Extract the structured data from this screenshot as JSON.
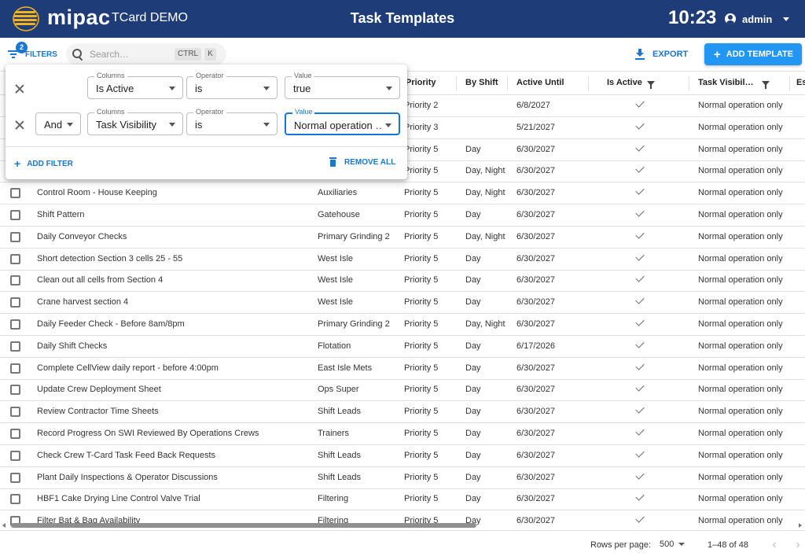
{
  "header": {
    "brand": "mipac",
    "org": "TCard DEMO",
    "title": "Task Templates",
    "clock": "10:23",
    "user": "admin"
  },
  "toolbar": {
    "filters_label": "FILTERS",
    "filter_count": "2",
    "search_placeholder": "Search…",
    "search_key_1": "CTRL",
    "search_key_2": "K",
    "export_label": "EXPORT",
    "add_template_label": "ADD TEMPLATE"
  },
  "filter_panel": {
    "row1": {
      "column_label": "Columns",
      "column": "Is Active",
      "operator_label": "Operator",
      "operator": "is",
      "value_label": "Value",
      "value": "true"
    },
    "row2": {
      "logic": "And",
      "column_label": "Columns",
      "column": "Task Visibility",
      "operator_label": "Operator",
      "operator": "is",
      "value_label": "Value",
      "value": "Normal operation …"
    },
    "add_filter_label": "ADD FILTER",
    "remove_all_label": "REMOVE ALL"
  },
  "columns": {
    "priority": "Priority",
    "by_shift": "By Shift",
    "active_until": "Active Until",
    "is_active": "Is Active",
    "task_visibility": "Task Visibil…",
    "extra": "Es"
  },
  "rows": [
    {
      "name": "",
      "area": "",
      "priority": "Priority 2",
      "shift": "",
      "until": "6/8/2027",
      "visibility": "Normal operation only"
    },
    {
      "name": "",
      "area": "",
      "priority": "Priority 3",
      "shift": "",
      "until": "5/21/2027",
      "visibility": "Normal operation only"
    },
    {
      "name": "",
      "area": "",
      "priority": "Priority 5",
      "shift": "Day",
      "until": "6/30/2027",
      "visibility": "Normal operation only"
    },
    {
      "name": "",
      "area": "",
      "priority": "Priority 5",
      "shift": "Day, Night",
      "until": "6/30/2027",
      "visibility": "Normal operation only"
    },
    {
      "name": "Control Room - House Keeping",
      "area": "Auxiliaries",
      "priority": "Priority 5",
      "shift": "Day, Night",
      "until": "6/30/2027",
      "visibility": "Normal operation only"
    },
    {
      "name": "Shift Pattern",
      "area": "Gatehouse",
      "priority": "Priority 5",
      "shift": "Day",
      "until": "6/30/2027",
      "visibility": "Normal operation only"
    },
    {
      "name": "Daily Conveyor Checks",
      "area": "Primary Grinding 2",
      "priority": "Priority 5",
      "shift": "Day, Night",
      "until": "6/30/2027",
      "visibility": "Normal operation only"
    },
    {
      "name": "Short detection Section 3 cells 25 - 55",
      "area": "West Isle",
      "priority": "Priority 5",
      "shift": "Day",
      "until": "6/30/2027",
      "visibility": "Normal operation only"
    },
    {
      "name": "Clean out all cells from Section 4",
      "area": "West Isle",
      "priority": "Priority 5",
      "shift": "Day",
      "until": "6/30/2027",
      "visibility": "Normal operation only"
    },
    {
      "name": "Crane harvest section 4",
      "area": "West Isle",
      "priority": "Priority 5",
      "shift": "Day",
      "until": "6/30/2027",
      "visibility": "Normal operation only"
    },
    {
      "name": "Daily Feeder Check - Before 8am/8pm",
      "area": "Primary Grinding 2",
      "priority": "Priority 5",
      "shift": "Day, Night",
      "until": "6/30/2027",
      "visibility": "Normal operation only"
    },
    {
      "name": "Daily Shift Checks",
      "area": "Flotation",
      "priority": "Priority 5",
      "shift": "Day",
      "until": "6/17/2026",
      "visibility": "Normal operation only"
    },
    {
      "name": "Complete CellView daily report - before 4:00pm",
      "area": "East Isle Mets",
      "priority": "Priority 5",
      "shift": "Day",
      "until": "6/30/2027",
      "visibility": "Normal operation only"
    },
    {
      "name": "Update Crew Deployment Sheet",
      "area": "Ops Super",
      "priority": "Priority 5",
      "shift": "Day",
      "until": "6/30/2027",
      "visibility": "Normal operation only"
    },
    {
      "name": "Review Contractor Time Sheets",
      "area": "Shift Leads",
      "priority": "Priority 5",
      "shift": "Day",
      "until": "6/30/2027",
      "visibility": "Normal operation only"
    },
    {
      "name": "Record Progress On SWI Reviewed By Operations Crews",
      "area": "Trainers",
      "priority": "Priority 5",
      "shift": "Day",
      "until": "6/30/2027",
      "visibility": "Normal operation only"
    },
    {
      "name": "Check Crew T-Card Task Feed Back Requests",
      "area": "Shift Leads",
      "priority": "Priority 5",
      "shift": "Day",
      "until": "6/30/2027",
      "visibility": "Normal operation only"
    },
    {
      "name": "Plant Daily Inspections & Operator Discussions",
      "area": "Shift Leads",
      "priority": "Priority 5",
      "shift": "Day",
      "until": "6/30/2027",
      "visibility": "Normal operation only"
    },
    {
      "name": "HBF1 Cake Drying Line Control Valve Trial",
      "area": "Filtering",
      "priority": "Priority 5",
      "shift": "Day",
      "until": "6/30/2027",
      "visibility": "Normal operation only"
    },
    {
      "name": "Filter Bat & Bag Availability",
      "area": "Filtering",
      "priority": "Priority 5",
      "shift": "Day",
      "until": "6/30/2027",
      "visibility": "Normal operation only"
    }
  ],
  "footer": {
    "rows_per_page_label": "Rows per page:",
    "rows_per_page": "500",
    "range": "1–48 of 48"
  }
}
